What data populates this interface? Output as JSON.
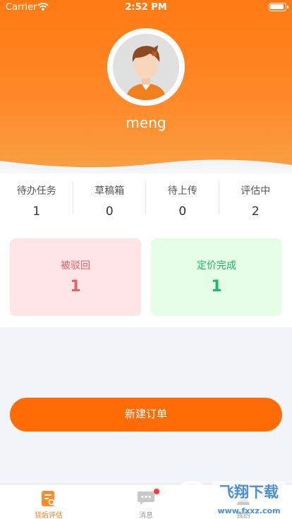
{
  "status_bar": {
    "carrier": "Carrier",
    "time": "2:52 PM"
  },
  "profile": {
    "username": "meng"
  },
  "stats": [
    {
      "label": "待办任务",
      "value": "1"
    },
    {
      "label": "草稿箱",
      "value": "0"
    },
    {
      "label": "待上传",
      "value": "0"
    },
    {
      "label": "评估中",
      "value": "2"
    }
  ],
  "cards": {
    "rejected": {
      "label": "被驳回",
      "value": "1"
    },
    "priced": {
      "label": "定价完成",
      "value": "1"
    }
  },
  "new_order_button": "新建订单",
  "tabbar": [
    {
      "label": "贷后评估",
      "icon": "document-search-icon",
      "active": true
    },
    {
      "label": "消息",
      "icon": "chat-icon",
      "badge": true
    },
    {
      "label": "我的",
      "icon": "profile-icon"
    }
  ],
  "watermark": {
    "brand": "飞翔下载",
    "url": "www.fxxz.com"
  },
  "colors": {
    "accent": "#ff7a12",
    "button": "#ff6c06",
    "rejected": "#e8606c",
    "priced": "#18bb68"
  }
}
